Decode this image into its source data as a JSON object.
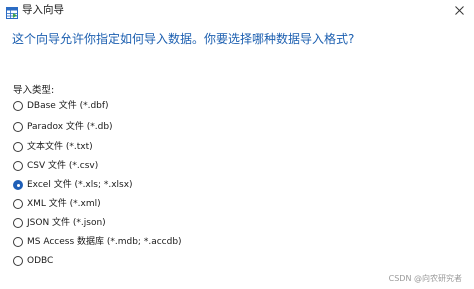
{
  "window": {
    "title": "导入向导"
  },
  "headline": "这个向导允许你指定如何导入数据。你要选择哪种数据导入格式?",
  "import_type": {
    "label": "导入类型:",
    "options": [
      {
        "label": "DBase 文件 (*.dbf)",
        "selected": false
      },
      {
        "label": "Paradox 文件 (*.db)",
        "selected": false
      },
      {
        "label": "文本文件 (*.txt)",
        "selected": false
      },
      {
        "label": "CSV 文件 (*.csv)",
        "selected": false
      },
      {
        "label": "Excel 文件 (*.xls; *.xlsx)",
        "selected": true
      },
      {
        "label": "XML 文件 (*.xml)",
        "selected": false
      },
      {
        "label": "JSON 文件 (*.json)",
        "selected": false
      },
      {
        "label": "MS Access 数据库 (*.mdb; *.accdb)",
        "selected": false
      },
      {
        "label": "ODBC",
        "selected": false
      }
    ]
  },
  "watermark": "CSDN @向农研究者",
  "colors": {
    "accent": "#1f5fb7",
    "headline": "#1c5fb0"
  },
  "icons": {
    "app": "table-wizard-icon",
    "close": "close-icon"
  }
}
